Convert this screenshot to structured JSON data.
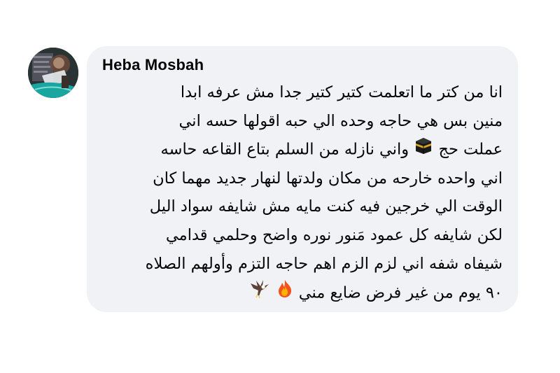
{
  "comment": {
    "author": "Heba Mosbah",
    "lines": [
      "انا من كتر ما اتعلمت كتير كتير جدا مش عرفه ابدا",
      "منين بس هي حاجه وحده الي حبه اقولها حسه اني",
      "عملت حج",
      "واني نازله من السلم بتاع القاعه حاسه",
      "اني واحده خارحه من مكان ولدتها لنهار جديد مهما كان",
      "الوقت الي خرجين فيه كنت مايه مش شايفه سواد اليل",
      "لكن شايفه كل عمود مَنور نوره واضح وحلمي قدامي",
      "شيفاه شفه اني لزم الزم اهم حاجه التزم وأولهم الصلاه",
      "٩٠ يوم من غير فرض ضايع مني"
    ],
    "emojis": {
      "kaaba": "kaaba-icon",
      "fire": "fire-icon",
      "eagle": "eagle-icon"
    }
  }
}
